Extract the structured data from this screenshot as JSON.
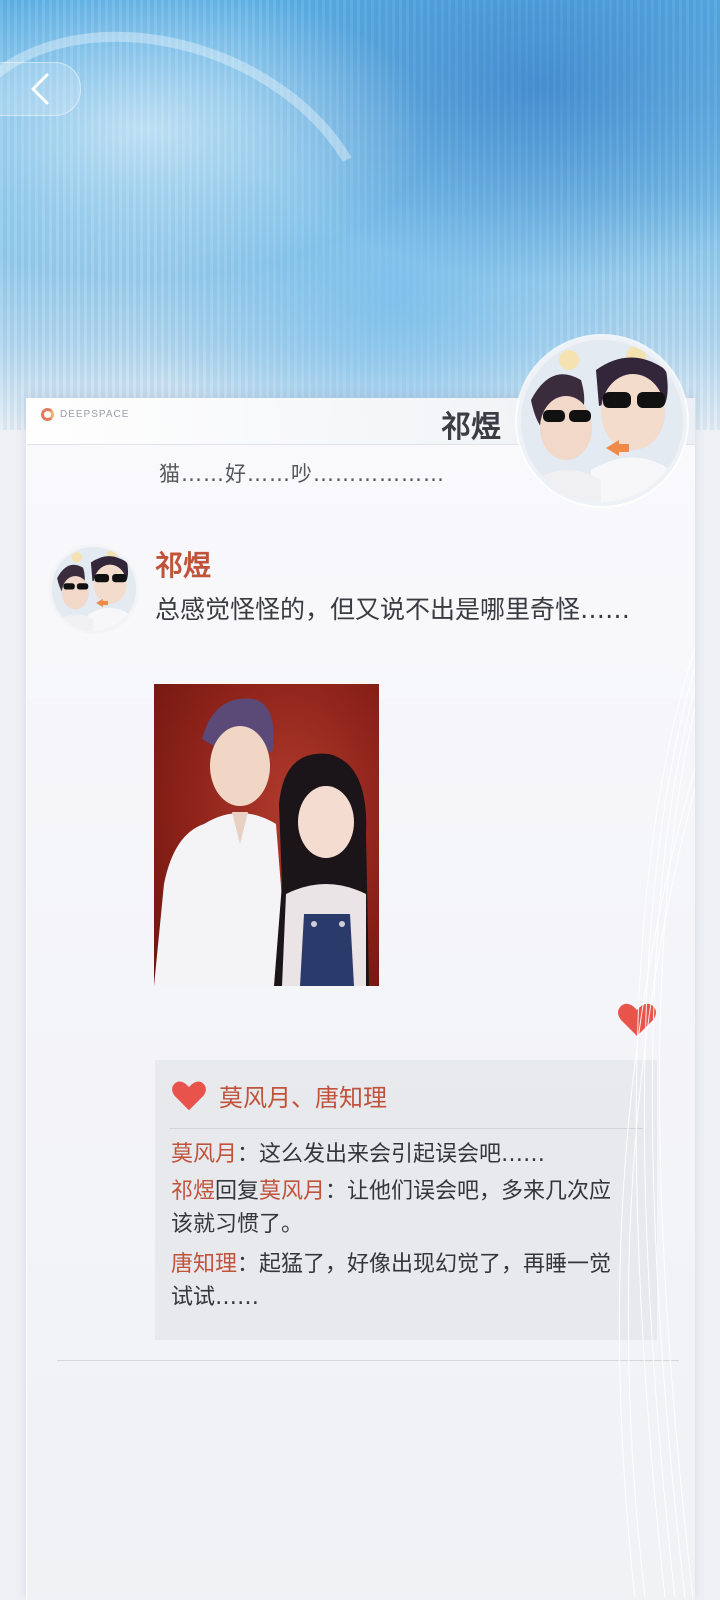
{
  "header": {
    "brand": "DEEPSPACE",
    "name": "祁煜",
    "signature": "猫……好……吵………………"
  },
  "post": {
    "author": "祁煜",
    "text": "总感觉怪怪的，但又说不出是哪里奇怪……"
  },
  "comments": {
    "liked_by": "莫风月、唐知理",
    "items": [
      {
        "name": "莫风月",
        "reply_to": "",
        "text": "：这么发出来会引起误会吧……"
      },
      {
        "name": "祁煜",
        "reply_label": "回复",
        "reply_to": "莫风月",
        "text": "：让他们误会吧，多来几次应该就习惯了。"
      },
      {
        "name": "唐知理",
        "reply_to": "",
        "text": "：起猛了，好像出现幻觉了，再睡一觉试试……"
      }
    ]
  },
  "colors": {
    "accent": "#c0533a",
    "heart": "#e8534c",
    "text": "#3a3b40"
  },
  "icons": {
    "back": "chevron-left-icon",
    "like": "heart-icon"
  }
}
